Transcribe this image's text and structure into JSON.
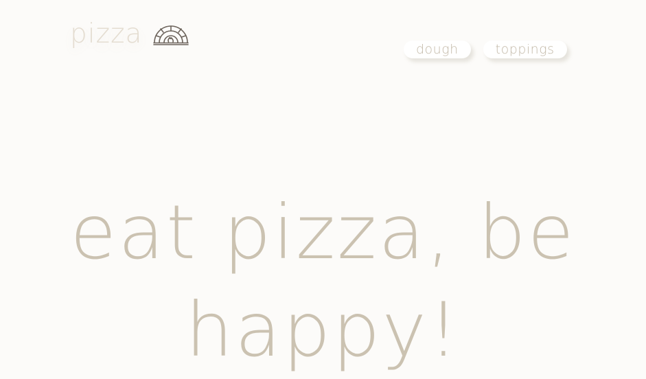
{
  "brand": {
    "name": "pizza",
    "icon": "pizza-oven-icon"
  },
  "nav": {
    "items": [
      {
        "label": "dough"
      },
      {
        "label": "toppings"
      }
    ]
  },
  "hero": {
    "line1": "eat pizza, be",
    "line2": "happy!"
  },
  "colors": {
    "background": "#fcfbf9",
    "text": "#cbc2b1",
    "logo_text": "#e4ddd1",
    "icon": "#6b625a",
    "button": "#ffffff"
  }
}
